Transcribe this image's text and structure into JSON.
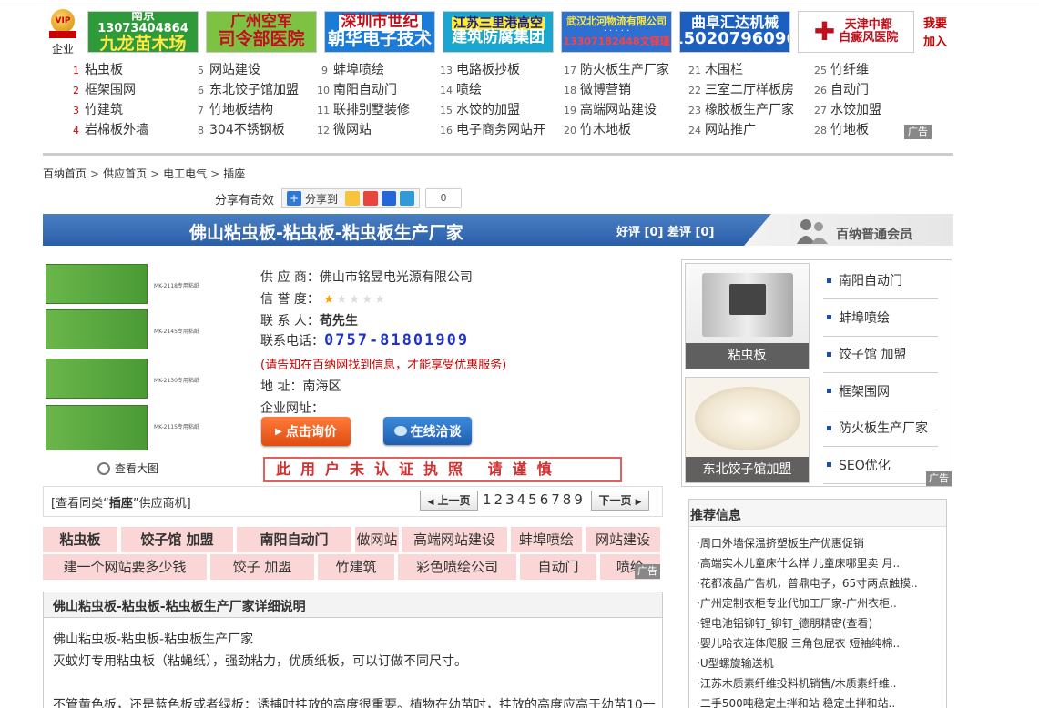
{
  "top_ads": {
    "vip_label": "企业",
    "vip_medal_text": "VIP",
    "banners": [
      {
        "line1": "南京 13073404864",
        "line2": "九龙苗木场"
      },
      {
        "line1": "广州空军",
        "line2": "司令部医院"
      },
      {
        "line1": "深圳市世纪",
        "line2": "朝华电子技术"
      },
      {
        "line1": "江苏三里港高空",
        "line2": "建筑防腐集团"
      },
      {
        "line1": "武汉北河物流有限公司",
        "line2": "13307182448文铎瑾"
      },
      {
        "line1": "曲阜汇达机械",
        "line2": "15020796096"
      },
      {
        "line1": "天津中都",
        "line2": "白癜风医院"
      }
    ],
    "join_text": "我要加入"
  },
  "keyword_grid": {
    "columns": [
      [
        {
          "n": "1",
          "text": "粘虫板"
        },
        {
          "n": "2",
          "text": "框架围网"
        },
        {
          "n": "3",
          "text": "竹建筑"
        },
        {
          "n": "4",
          "text": "岩棉板外墙"
        }
      ],
      [
        {
          "n": "5",
          "text": "网站建设"
        },
        {
          "n": "6",
          "text": "东北饺子馆加盟"
        },
        {
          "n": "7",
          "text": "竹地板结构"
        },
        {
          "n": "8",
          "text": "304不锈钢板"
        }
      ],
      [
        {
          "n": "9",
          "text": "蚌埠喷绘"
        },
        {
          "n": "10",
          "text": "南阳自动门"
        },
        {
          "n": "11",
          "text": "联排别墅装修"
        },
        {
          "n": "12",
          "text": "微网站"
        }
      ],
      [
        {
          "n": "13",
          "text": "电路板抄板"
        },
        {
          "n": "14",
          "text": "喷绘"
        },
        {
          "n": "15",
          "text": "水饺的加盟"
        },
        {
          "n": "16",
          "text": "电子商务网站开"
        }
      ],
      [
        {
          "n": "17",
          "text": "防火板生产厂家"
        },
        {
          "n": "18",
          "text": "微博营销"
        },
        {
          "n": "19",
          "text": "高端网站建设"
        },
        {
          "n": "20",
          "text": "竹木地板"
        }
      ],
      [
        {
          "n": "21",
          "text": "木围栏"
        },
        {
          "n": "22",
          "text": "三室二厅样板房"
        },
        {
          "n": "23",
          "text": "橡胶板生产厂家"
        },
        {
          "n": "24",
          "text": "网站推广"
        }
      ],
      [
        {
          "n": "25",
          "text": "竹纤维"
        },
        {
          "n": "26",
          "text": "自动门"
        },
        {
          "n": "27",
          "text": "水饺加盟"
        },
        {
          "n": "28",
          "text": "竹地板"
        }
      ]
    ],
    "ad_tag": "广告"
  },
  "breadcrumb": [
    "百纳首页",
    "供应首页",
    "电工电气",
    "插座"
  ],
  "share": {
    "label": "分享有奇效",
    "button": "分享到",
    "count": "0"
  },
  "product": {
    "title": "佛山粘虫板-粘虫板-粘虫板生产厂家",
    "rating_text": "好评 [0] 差评 [0]",
    "member_label": "百纳普通会员",
    "view_large": "查看大图",
    "pack_labels": [
      "MK-2118专用粘纸",
      "MK-2145专用粘纸",
      "MK-2130专用粘纸",
      "MK-2115专用粘纸"
    ]
  },
  "info": {
    "supplier_label": "供 应 商：",
    "supplier": "佛山市铭昱电光源有限公司",
    "credit_label": "信 誉 度：",
    "credit_stars": 1,
    "credit_max": 5,
    "contact_label": "联 系 人：",
    "contact": "苟先生",
    "phone_label": "联系电话：",
    "phone": "0757-81801909",
    "notice": "(请告知在百纳网找到信息，才能享受优惠服务)",
    "address_label": "地  址：",
    "address": "南海区",
    "website_label": "企业网址：",
    "website": "",
    "inquiry_button": "点击询价",
    "chat_button": "在线洽谈",
    "stamp": "此用户未认证执照 请谨慎"
  },
  "sidebar": {
    "images": [
      {
        "caption": "粘虫板"
      },
      {
        "caption": "东北饺子馆加盟"
      }
    ],
    "links": [
      "南阳自动门",
      "蚌埠喷绘",
      "饺子馆 加盟",
      "框架围网",
      "防火板生产厂家",
      "SEO优化"
    ],
    "ad_tag": "广告"
  },
  "pagination": {
    "same_prefix": "[查看同类“",
    "same_keyword": "插座",
    "same_suffix": "”供应商机]",
    "prev": "上一页",
    "pages": "123456789",
    "next": "下一页"
  },
  "keyword_table": {
    "row1": [
      "粘虫板",
      "饺子馆 加盟",
      "南阳自动门",
      "做网站",
      "高端网站建设",
      "蚌埠喷绘",
      "网站建设"
    ],
    "row2": [
      "建一个网站要多少钱",
      "饺子 加盟",
      "竹建筑",
      "彩色喷绘公司",
      "自动门",
      "喷绘"
    ],
    "ad_tag": "广告"
  },
  "detail": {
    "title": "佛山粘虫板-粘虫板-粘虫板生产厂家详细说明",
    "lines": [
      "佛山粘虫板-粘虫板-粘虫板生产厂家",
      "灭蚊灯专用粘虫板（粘蝇纸），强劲粘力，优质纸板，可以订做不同尺寸。",
      "不管黄色板，还是蓝色板或者绿板：诱捕时挂放的高度很重要。植物在幼苗时，挂放的高度应高于幼苗10一"
    ]
  },
  "recommend": {
    "title": "推荐信息",
    "items": [
      "·周口外墙保温挤塑板生产优惠促销",
      "·高端实木儿童床什么样 儿童床哪里卖 月..",
      "·花都液晶广告机，普鼎电子，65寸两点触摸..",
      "·广州定制衣柜专业代加工厂家-广州衣柜..",
      "·锂电池铝铆钉_铆钉_德朋精密(查看)",
      "·婴儿哈衣连体爬服 三角包屁衣 短袖纯棉..",
      "·U型螺旋输送机",
      "·江苏木质素纤维投料机销售/木质素纤维..",
      "·二手500吨稳定土拌和站 稳定土拌和站.."
    ]
  }
}
